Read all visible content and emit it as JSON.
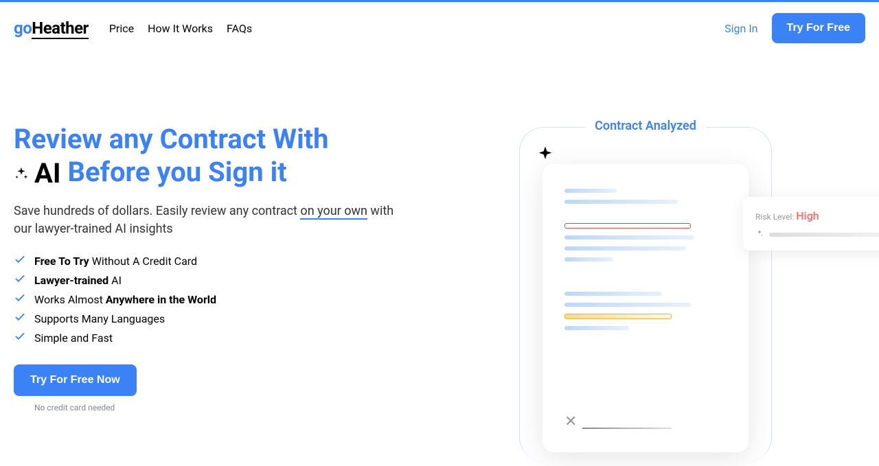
{
  "brand": {
    "go": "go",
    "heather": "Heather"
  },
  "nav": {
    "price": "Price",
    "how": "How It Works",
    "faqs": "FAQs"
  },
  "auth": {
    "signin": "Sign In",
    "try_free": "Try For Free"
  },
  "hero": {
    "title_line1": "Review any Contract With",
    "title_ai": "AI",
    "title_line2": "Before you Sign it",
    "subtitle_a": "Save hundreds of dollars. Easily review any contract ",
    "subtitle_underline": "on your own",
    "subtitle_b": " with our lawyer-trained AI insights",
    "cta": "Try For Free Now",
    "no_card": "No credit card needed"
  },
  "features": [
    {
      "bold": "Free To Try",
      "rest": " Without A Credit Card"
    },
    {
      "bold": "Lawyer-trained",
      "rest": " AI"
    },
    {
      "pre": "Works Almost ",
      "bold": "Anywhere in the World",
      "rest": ""
    },
    {
      "bold": "",
      "rest": "Supports Many Languages"
    },
    {
      "bold": "",
      "rest": "Simple and Fast"
    }
  ],
  "illustration": {
    "analyzed_label": "Contract Analyzed",
    "risk_label": "Risk Level: ",
    "risk_value": "High"
  }
}
